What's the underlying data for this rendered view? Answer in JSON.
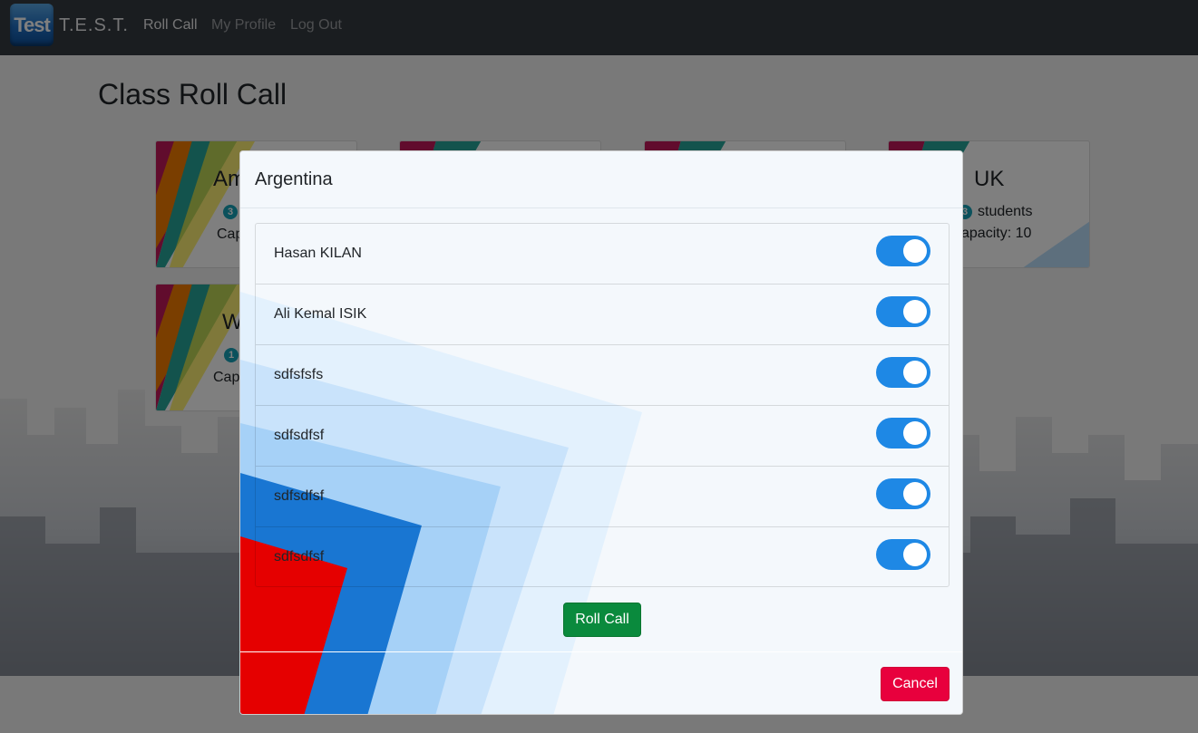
{
  "navbar": {
    "logo_text": "Test",
    "brand": "T.E.S.T.",
    "links": [
      {
        "label": "Roll Call",
        "active": true
      },
      {
        "label": "My Profile",
        "active": false
      },
      {
        "label": "Log Out",
        "active": false
      }
    ]
  },
  "page": {
    "title": "Class Roll Call",
    "cards": [
      {
        "title_visible": "Am",
        "badge": "3",
        "text_visible": "Cap"
      },
      {
        "title_visible": "UK",
        "badge": "3",
        "students_label": "students",
        "capacity_visible": "apacity: 10"
      },
      {
        "title_visible": "W",
        "badge": "1",
        "text_visible": "Cap"
      }
    ]
  },
  "modal": {
    "title": "Argentina",
    "students": [
      {
        "name": "Hasan KILAN",
        "present": true
      },
      {
        "name": "Ali Kemal ISIK",
        "present": true
      },
      {
        "name": "sdfsfsfs",
        "present": true
      },
      {
        "name": "sdfsdfsf",
        "present": true
      },
      {
        "name": "sdfsdfsf",
        "present": true
      },
      {
        "name": "sdfsdfsf",
        "present": true
      }
    ],
    "rollcall_label": "Roll Call",
    "cancel_label": "Cancel"
  },
  "colors": {
    "navbar": "#343a40",
    "toggle_on": "#1e88e5",
    "rollcall_button": "#0a8a3d",
    "cancel_button": "#e8003d",
    "badge": "#17a2b8"
  }
}
